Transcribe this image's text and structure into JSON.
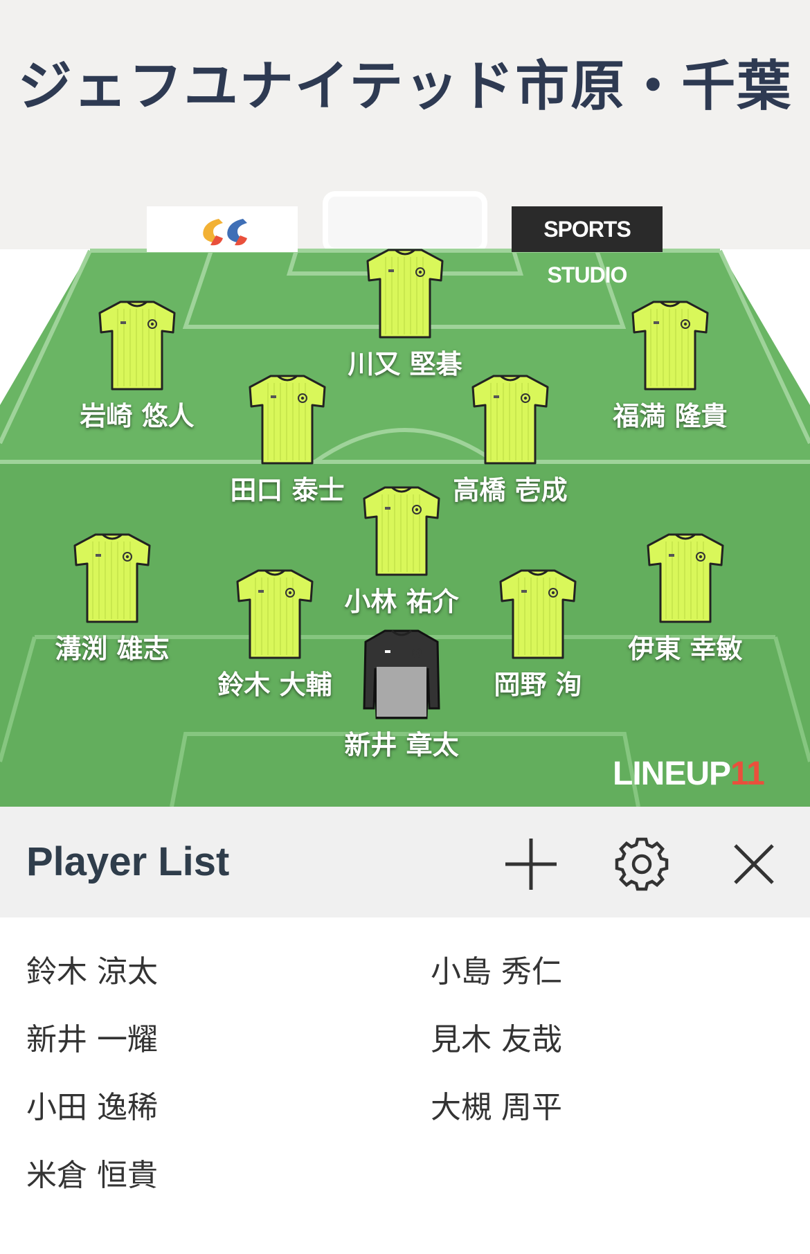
{
  "team_name": "ジェフユナイテッド市原・千葉",
  "sponsors": {
    "right_label": "SPORTS STUDIO"
  },
  "brand": {
    "lineup_text": "LINEUP",
    "lineup_num": "11"
  },
  "colors": {
    "pitch_light": "#6db866",
    "pitch_dark": "#63ad5e",
    "kit": "#d9f75a",
    "gk_kit": "#333333",
    "header_bg": "#f2f1ef"
  },
  "icons": {
    "add": "plus-icon",
    "settings": "gear-icon",
    "close": "close-icon"
  },
  "players": [
    {
      "name": "川又 堅碁",
      "keeper": false
    },
    {
      "name": "岩崎 悠人",
      "keeper": false
    },
    {
      "name": "福満 隆貴",
      "keeper": false
    },
    {
      "name": "田口 泰士",
      "keeper": false
    },
    {
      "name": "高橋 壱成",
      "keeper": false
    },
    {
      "name": "小林 祐介",
      "keeper": false
    },
    {
      "name": "溝渕 雄志",
      "keeper": false
    },
    {
      "name": "伊東 幸敏",
      "keeper": false
    },
    {
      "name": "鈴木 大輔",
      "keeper": false
    },
    {
      "name": "岡野 洵",
      "keeper": false
    },
    {
      "name": "新井 章太",
      "keeper": true
    }
  ],
  "player_list": {
    "title": "Player List",
    "left": [
      "鈴木 涼太",
      "新井 一耀",
      "小田 逸稀",
      "米倉 恒貴"
    ],
    "right": [
      "小島 秀仁",
      "見木 友哉",
      "大槻 周平"
    ]
  }
}
